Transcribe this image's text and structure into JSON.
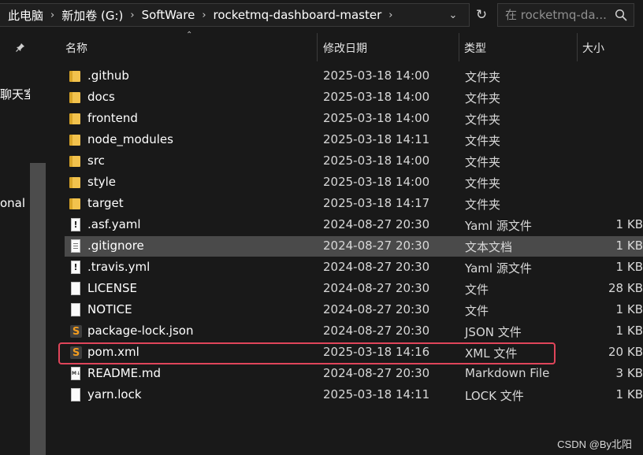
{
  "address": {
    "crumbs": [
      "此电脑",
      "新加卷 (G:)",
      "SoftWare",
      "rocketmq-dashboard-master"
    ],
    "separator": "›",
    "dropdown": "⌄",
    "refresh": "↻"
  },
  "search": {
    "placeholder": "在 rocketmq-da..."
  },
  "nav": {
    "pin": "📌",
    "frag1": "聊天室",
    "frag2": "onal"
  },
  "columns": {
    "name": "名称",
    "date": "修改日期",
    "type": "类型",
    "size": "大小",
    "sort_arrow": "⌃"
  },
  "files": [
    {
      "name": ".github",
      "date": "2025-03-18 14:00",
      "type": "文件夹",
      "size": "",
      "icon": "folder-icon"
    },
    {
      "name": "docs",
      "date": "2025-03-18 14:00",
      "type": "文件夹",
      "size": "",
      "icon": "folder-icon"
    },
    {
      "name": "frontend",
      "date": "2025-03-18 14:00",
      "type": "文件夹",
      "size": "",
      "icon": "folder-icon"
    },
    {
      "name": "node_modules",
      "date": "2025-03-18 14:11",
      "type": "文件夹",
      "size": "",
      "icon": "folder-icon"
    },
    {
      "name": "src",
      "date": "2025-03-18 14:00",
      "type": "文件夹",
      "size": "",
      "icon": "folder-icon"
    },
    {
      "name": "style",
      "date": "2025-03-18 14:00",
      "type": "文件夹",
      "size": "",
      "icon": "folder-icon"
    },
    {
      "name": "target",
      "date": "2025-03-18 14:17",
      "type": "文件夹",
      "size": "",
      "icon": "folder-icon"
    },
    {
      "name": ".asf.yaml",
      "date": "2024-08-27 20:30",
      "type": "Yaml 源文件",
      "size": "1 KB",
      "icon": "yaml-file-icon"
    },
    {
      "name": ".gitignore",
      "date": "2024-08-27 20:30",
      "type": "文本文档",
      "size": "1 KB",
      "icon": "text-file-icon"
    },
    {
      "name": ".travis.yml",
      "date": "2024-08-27 20:30",
      "type": "Yaml 源文件",
      "size": "1 KB",
      "icon": "yaml-file-icon"
    },
    {
      "name": "LICENSE",
      "date": "2024-08-27 20:30",
      "type": "文件",
      "size": "28 KB",
      "icon": "file-icon"
    },
    {
      "name": "NOTICE",
      "date": "2024-08-27 20:30",
      "type": "文件",
      "size": "1 KB",
      "icon": "file-icon"
    },
    {
      "name": "package-lock.json",
      "date": "2024-08-27 20:30",
      "type": "JSON 文件",
      "size": "1 KB",
      "icon": "sublime-file-icon"
    },
    {
      "name": "pom.xml",
      "date": "2025-03-18 14:16",
      "type": "XML 文件",
      "size": "20 KB",
      "icon": "sublime-file-icon"
    },
    {
      "name": "README.md",
      "date": "2024-08-27 20:30",
      "type": "Markdown File",
      "size": "3 KB",
      "icon": "markdown-file-icon"
    },
    {
      "name": "yarn.lock",
      "date": "2025-03-18 14:11",
      "type": "LOCK 文件",
      "size": "1 KB",
      "icon": "file-icon"
    }
  ],
  "selected_file": ".gitignore",
  "highlighted_file": "pom.xml",
  "watermark": "CSDN @By北阳",
  "colors": {
    "background": "#191919",
    "selection": "#4a4a4a",
    "highlight_border": "#e0455a",
    "folder": "#f2c24d"
  }
}
